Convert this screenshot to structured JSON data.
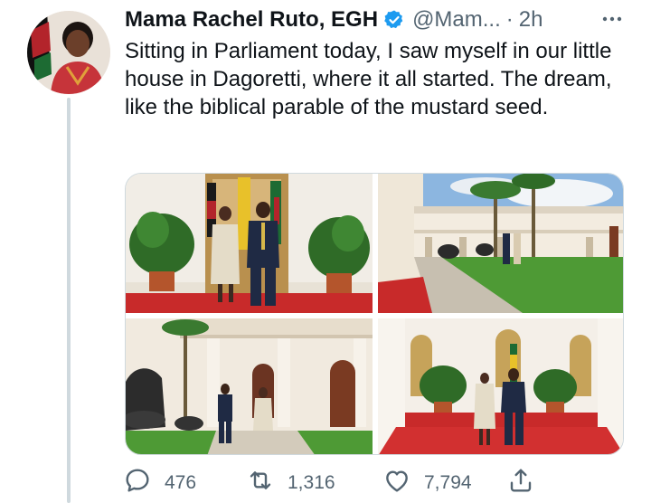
{
  "tweet": {
    "author_name": "Mama Rachel Ruto, EGH",
    "handle": "@Mam...",
    "separator": "·",
    "time": "2h",
    "text": "Sitting in Parliament today, I saw myself in our little house in Dagoretti, where it all started. The dream, like the biblical parable of the mustard seed.",
    "verified": true
  },
  "icons": {
    "verified": "verified-badge-icon",
    "more": "more-options-icon",
    "reply": "reply-icon",
    "retweet": "retweet-icon",
    "like": "like-icon",
    "share": "share-icon"
  },
  "stats": {
    "replies": "476",
    "retweets": "1,316",
    "likes": "7,794"
  },
  "media": {
    "photos": [
      {
        "description": "couple-portrait-flags"
      },
      {
        "description": "courtyard-garden"
      },
      {
        "description": "colonnade-statues"
      },
      {
        "description": "couple-portrait-red-carpet"
      }
    ]
  },
  "colors": {
    "accent": "#1d9bf0",
    "secondary_text": "#536471",
    "primary_text": "#0f1419",
    "thread_line": "#cfd9de"
  }
}
